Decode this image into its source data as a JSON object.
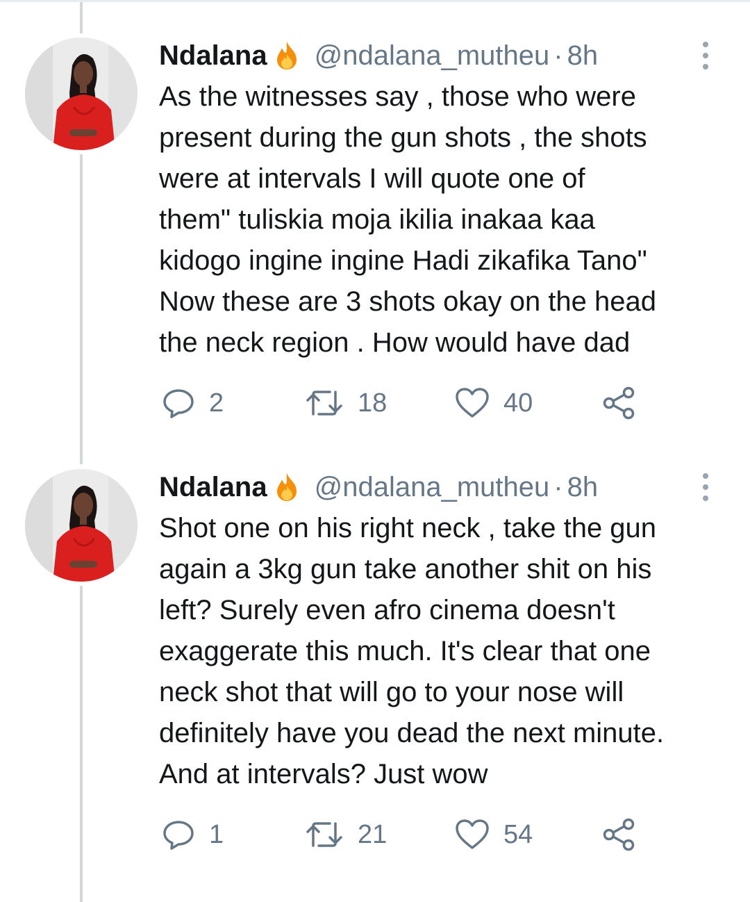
{
  "tweets": [
    {
      "name": "Ndalana",
      "handle": "@ndalana_mutheu",
      "separator": "·",
      "time": "8h",
      "text": "As the witnesses say , those who were\npresent during the gun shots , the shots\nwere at intervals I will quote one of\nthem\" tuliskia moja ikilia inakaa kaa\nkidogo ingine ingine Hadi zikafika Tano\"\nNow these are 3 shots okay on the head\nthe neck region . How would have dad",
      "replies": "2",
      "retweets": "18",
      "likes": "40"
    },
    {
      "name": "Ndalana",
      "handle": "@ndalana_mutheu",
      "separator": "·",
      "time": "8h",
      "text": "Shot one on his right neck , take the gun\nagain a 3kg gun take another shit on his\nleft? Surely even afro cinema doesn't\nexaggerate this much. It's clear that one\nneck shot that will go to your nose will\ndefinitely have you dead the next minute.\nAnd at intervals? Just wow",
      "replies": "1",
      "retweets": "21",
      "likes": "54"
    }
  ],
  "icons": {
    "emoji": "fire-icon",
    "reply": "reply-icon",
    "retweet": "retweet-icon",
    "like": "like-icon",
    "share": "share-icon",
    "more": "more-icon"
  },
  "colors": {
    "text": "#14171a",
    "secondary": "#657786",
    "thread_line": "#cfd9de",
    "dress": "#d9201f"
  }
}
